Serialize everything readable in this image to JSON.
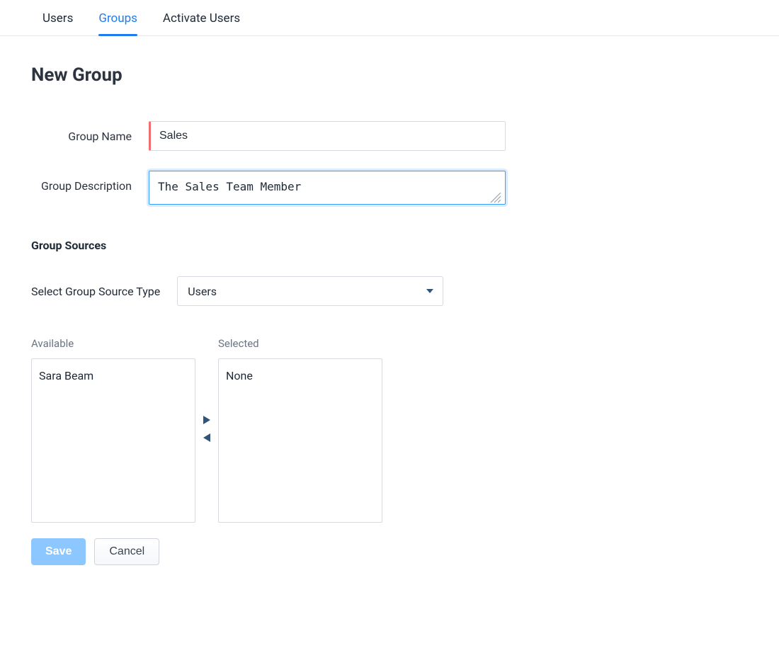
{
  "tabs": {
    "items": [
      {
        "label": "Users",
        "active": false
      },
      {
        "label": "Groups",
        "active": true
      },
      {
        "label": "Activate Users",
        "active": false
      }
    ]
  },
  "page": {
    "title": "New Group"
  },
  "form": {
    "group_name": {
      "label": "Group Name",
      "value": "Sales"
    },
    "group_description": {
      "label": "Group Description",
      "value": "The Sales Team Member"
    }
  },
  "sources": {
    "section_title": "Group Sources",
    "select_label": "Select Group Source Type",
    "selected_type": "Users"
  },
  "dual_list": {
    "available_title": "Available",
    "selected_title": "Selected",
    "available": [
      "Sara Beam"
    ],
    "selected_placeholder": "None"
  },
  "buttons": {
    "save": "Save",
    "cancel": "Cancel"
  }
}
